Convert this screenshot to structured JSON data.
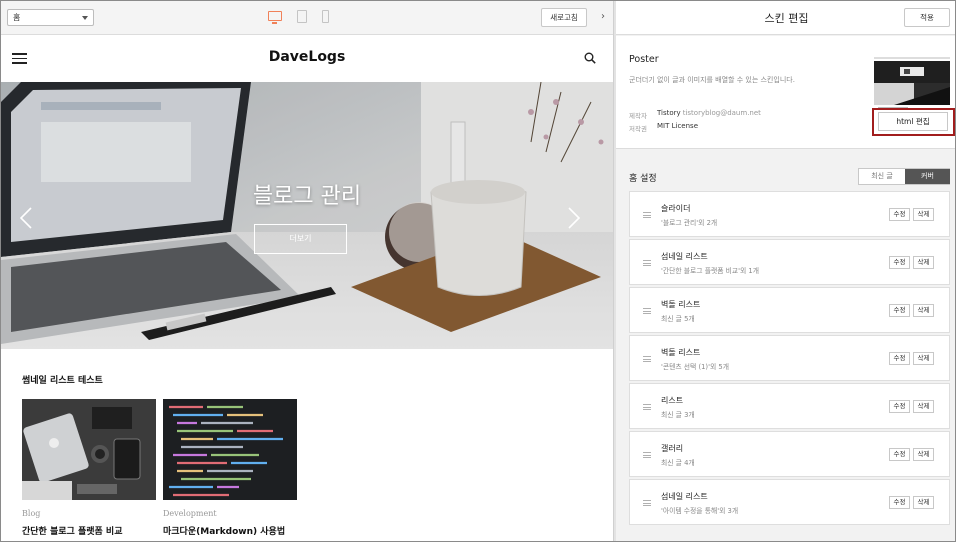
{
  "toolbar": {
    "page_select": "홈",
    "refresh_label": "새로고침"
  },
  "blog": {
    "title": "DaveLogs",
    "hero_text": "블로그 관리",
    "hero_button": "더보기",
    "section_title": "썸네일 리스트 테스트",
    "posts": [
      {
        "category": "Blog",
        "title": "간단한 블로그 플랫폼 비교"
      },
      {
        "category": "Development",
        "title": "마크다운(Markdown) 사용법"
      }
    ]
  },
  "editor": {
    "title": "스킨 편집",
    "apply_label": "적용",
    "skin_name": "Poster",
    "skin_desc": "군더더기 없이 글과 이미지를 배열할 수 있는 스킨입니다.",
    "author_label": "제작자",
    "author_name": "Tistory",
    "author_email": "tistoryblog@daum.net",
    "license_label": "저작권",
    "license_value": "MIT License",
    "html_edit_label": "html 편집",
    "home_settings_label": "홈 설정",
    "tab_latest": "최신 글",
    "tab_cover": "커버",
    "edit_label": "수정",
    "delete_label": "삭제",
    "modules": [
      {
        "title": "슬라이더",
        "sub": "'블로그 관리'외 2개"
      },
      {
        "title": "섬네일 리스트",
        "sub": "'간단한 블로그 플랫폼 비교'외 1개"
      },
      {
        "title": "벽돌 리스트",
        "sub": "최신 글 5개"
      },
      {
        "title": "벽돌 리스트",
        "sub": "'콘텐츠 선택 (1)'외 5개"
      },
      {
        "title": "리스트",
        "sub": "최신 글 3개"
      },
      {
        "title": "갤러리",
        "sub": "최신 글 4개"
      },
      {
        "title": "섬네일 리스트",
        "sub": "'아이템 수정을 통해'외 3개"
      }
    ]
  },
  "colors": {
    "accent_device": "#f08159",
    "highlight_border": "#a11d1d",
    "active_tab": "#555555"
  }
}
